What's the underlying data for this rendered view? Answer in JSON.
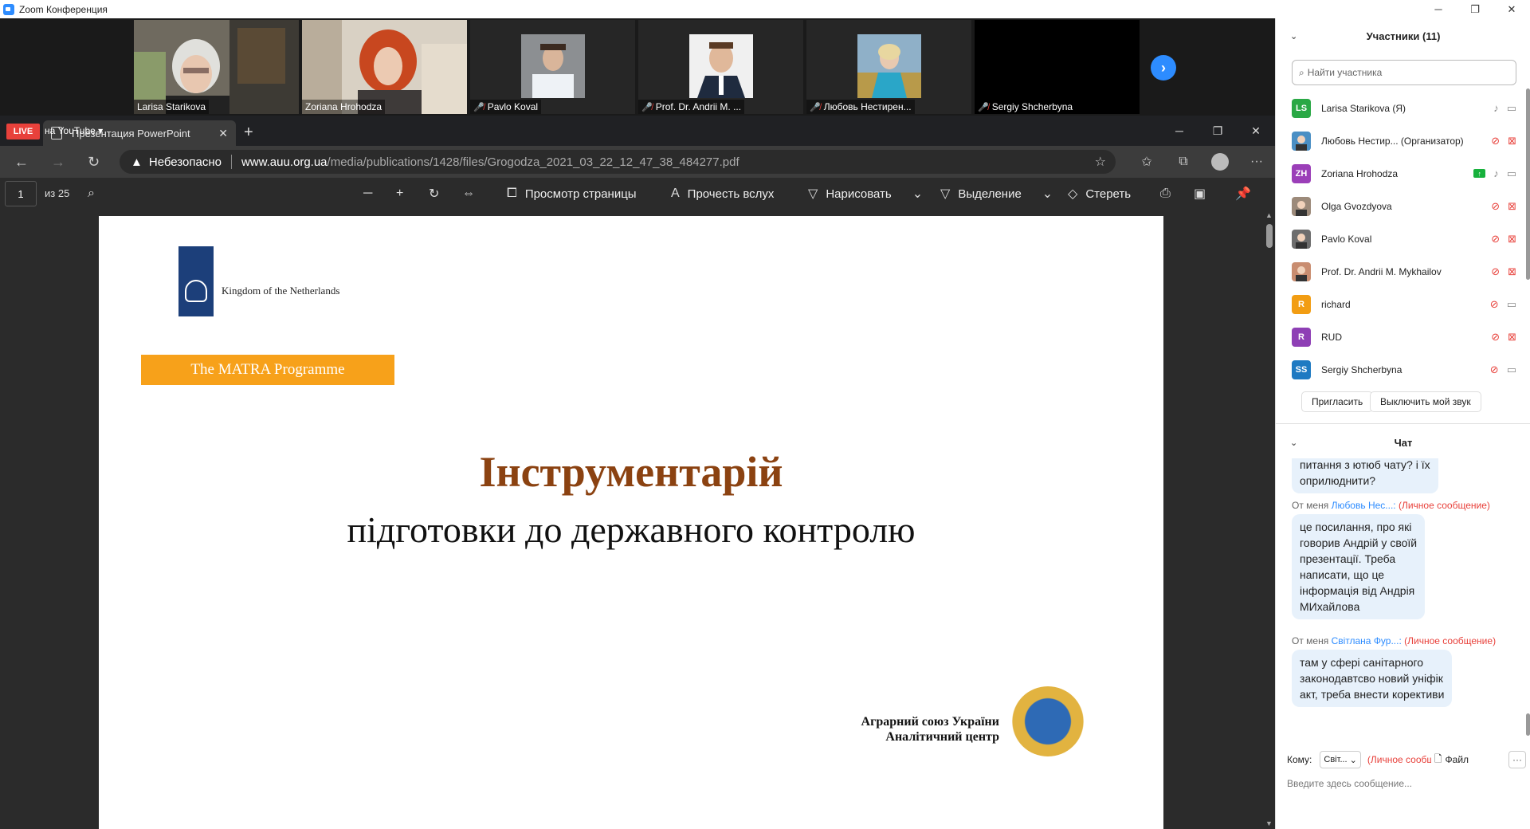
{
  "zoom": {
    "title": "Zoom Конференция",
    "window_controls": [
      "─",
      "❐",
      "✕"
    ]
  },
  "video_tiles": [
    {
      "name": "Larisa Starikova",
      "muted": false,
      "active": false
    },
    {
      "name": "Zoriana Hrohodza",
      "muted": false,
      "active": true
    },
    {
      "name": "Pavlo Koval",
      "muted": true,
      "active": false
    },
    {
      "name": "Prof. Dr. Andrii M. ...",
      "muted": true,
      "active": false
    },
    {
      "name": "Любовь Нестирен...",
      "muted": true,
      "active": false
    },
    {
      "name": "Sergiy Shcherbyna",
      "muted": true,
      "active": false
    }
  ],
  "live": {
    "badge": "LIVE",
    "target": "на YouTube ▾"
  },
  "browser": {
    "tab_title": "Презентация PowerPoint",
    "tab_close": "✕",
    "new_tab": "+",
    "window_controls": [
      "─",
      "❐",
      "✕"
    ],
    "nav": {
      "back": "←",
      "forward": "→",
      "reload": "↻"
    },
    "security_icon": "▲",
    "security_text": "Небезопасно",
    "url_host": "www.auu.org.ua",
    "url_path": "/media/publications/1428/files/Grogodza_2021_03_22_12_47_38_484277.pdf"
  },
  "pdf": {
    "page": "1",
    "page_count": "из 25",
    "tools": {
      "page_view": "Просмотр страницы",
      "read_aloud": "Прочесть вслух",
      "draw": "Нарисовать",
      "highlight": "Выделение",
      "erase": "Стереть"
    }
  },
  "slide": {
    "logo_text": "Kingdom of the Netherlands",
    "matra": "The MATRA Programme",
    "title": "Інструментарій",
    "subtitle": "підготовки до державного контролю",
    "org_line1": "Аграрний союз України",
    "org_line2": "Аналітичний центр"
  },
  "participants": {
    "header": "Участники (11)",
    "search_placeholder": "Найти участника",
    "list": [
      {
        "initials": "LS",
        "color": "#2aa845",
        "name": "Larisa Starikova (Я)",
        "mic": "on",
        "cam": "on",
        "photo": false
      },
      {
        "initials": "",
        "color": "#4a8fc4",
        "name": "Любовь Нестир... (Организатор)",
        "mic": "off",
        "cam": "off",
        "photo": true
      },
      {
        "initials": "ZH",
        "color": "#9b3fb8",
        "name": "Zoriana Hrohodza",
        "mic": "on",
        "cam": "on",
        "photo": false,
        "sharing": true
      },
      {
        "initials": "",
        "color": "#9c8a7a",
        "name": "Olga Gvozdyova",
        "mic": "off",
        "cam": "off",
        "photo": true
      },
      {
        "initials": "",
        "color": "#6d6d6d",
        "name": "Pavlo Koval",
        "mic": "off",
        "cam": "off",
        "photo": true
      },
      {
        "initials": "",
        "color": "#c98d70",
        "name": "Prof. Dr. Andrii M. Mykhailov",
        "mic": "off",
        "cam": "off",
        "photo": true
      },
      {
        "initials": "R",
        "color": "#f29d13",
        "name": "richard",
        "mic": "off",
        "cam": "on",
        "photo": false
      },
      {
        "initials": "R",
        "color": "#8e3fb5",
        "name": "RUD",
        "mic": "off",
        "cam": "off",
        "photo": false
      },
      {
        "initials": "SS",
        "color": "#1f7ac2",
        "name": "Sergiy Shcherbyna",
        "mic": "off",
        "cam": "on",
        "photo": false
      }
    ],
    "invite": "Пригласить",
    "mute_me": "Выключить мой звук"
  },
  "chat": {
    "header": "Чат",
    "messages": [
      {
        "text_lines": [
          "питання з ютюб чату? і їх",
          "оприлюднити?"
        ]
      },
      {
        "from": "От меня",
        "to": "Любовь Нес...:",
        "private": "(Личное сообщение)",
        "text_lines": [
          "це посилання, про які",
          "говорив Андрій у своїй",
          "презентації. Треба",
          "написати, що це",
          "інформація від Андрія",
          "МИхайлова"
        ]
      },
      {
        "from": "От меня",
        "to": "Світлана Фур...:",
        "private": "(Личное сообщение)",
        "text_lines": [
          "там у сфері санітарного",
          "законодавтсво новий уніфік",
          "акт, треба внести корективи"
        ]
      }
    ],
    "to_label": "Кому:",
    "to_value": "Світ...",
    "to_private": "(Личное сообщение)",
    "file_label": "Файл",
    "more": "···",
    "input_placeholder": "Введите здесь сообщение..."
  }
}
